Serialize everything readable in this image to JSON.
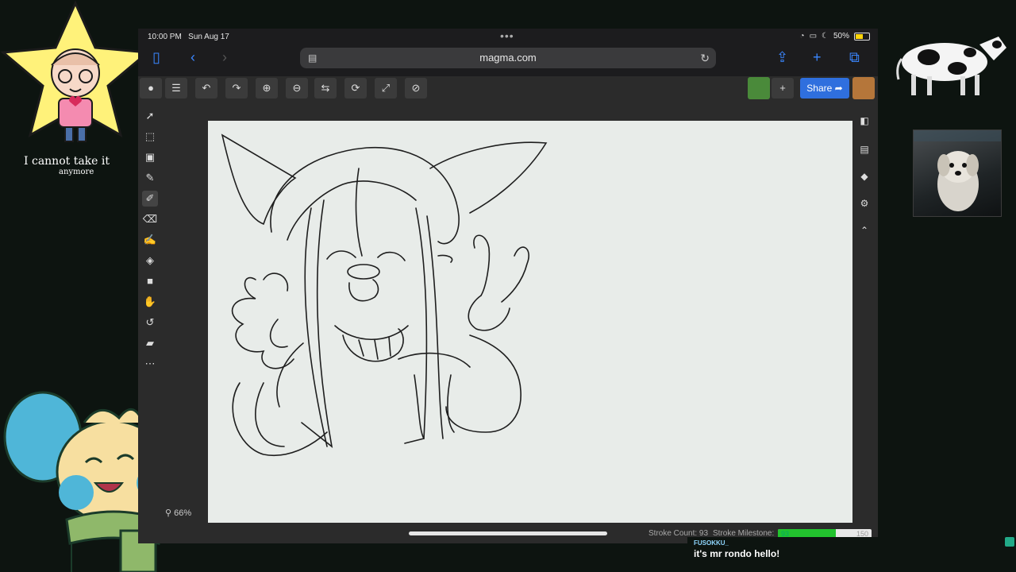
{
  "status_bar": {
    "time": "10:00 PM",
    "date": "Sun Aug 17",
    "battery": "50%"
  },
  "browser": {
    "url": "magma.com"
  },
  "toolbar": {
    "share_label": "Share"
  },
  "canvas": {
    "zoom": "66%"
  },
  "bottom_bar": {
    "stroke_count_label": "Stroke Count: 93",
    "stroke_milestone_label": "Stroke Milestone:",
    "progress_current": "93",
    "progress_target": "150",
    "progress_fraction": 0.62
  },
  "overlay": {
    "star_caption_line1": "I cannot take it",
    "star_caption_line2": "anymore"
  },
  "chat": {
    "username": "FUSOKKU_",
    "message": "it's mr rondo hello!"
  },
  "colors": {
    "accent_blue": "#2f6fde",
    "progress_green": "#22c32e",
    "canvas_bg": "#e8ece9"
  }
}
